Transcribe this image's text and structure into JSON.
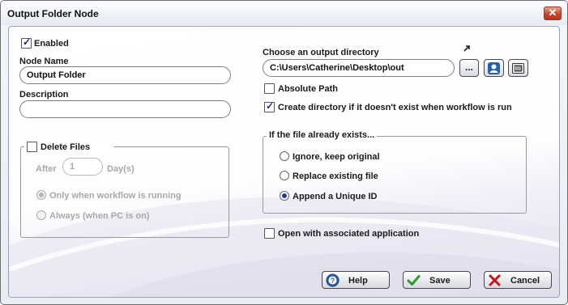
{
  "window": {
    "title": "Output Folder Node",
    "close_glyph": "✕"
  },
  "left": {
    "enabled_label": "Enabled",
    "enabled_checked": true,
    "node_name_label": "Node Name",
    "node_name_value": "Output Folder",
    "description_label": "Description",
    "description_value": ""
  },
  "delete_files": {
    "label": "Delete Files",
    "checked": false,
    "after_label": "After",
    "after_value": "1",
    "days_label": "Day(s)",
    "options": [
      {
        "label": "Only when workflow is running",
        "selected": true
      },
      {
        "label": "Always (when PC is on)",
        "selected": false
      }
    ]
  },
  "output": {
    "choose_label": "Choose an output directory",
    "directory_value": "C:\\Users\\Catherine\\Desktop\\out",
    "browse_label": "...",
    "absolute_path_label": "Absolute Path",
    "absolute_path_checked": false,
    "create_dir_label": "Create directory if it doesn't exist when workflow is run",
    "create_dir_checked": true
  },
  "exists_group": {
    "legend": "If the file already exists...",
    "options": [
      {
        "label": "Ignore, keep original",
        "selected": false
      },
      {
        "label": "Replace existing file",
        "selected": false
      },
      {
        "label": "Append a Unique ID",
        "selected": true
      }
    ]
  },
  "open_with": {
    "label": "Open with associated application",
    "checked": false
  },
  "buttons": {
    "help": "Help",
    "save": "Save",
    "cancel": "Cancel"
  },
  "icons": {
    "external_link": "arrow-up-right-icon",
    "user_vars": "user-variables-icon",
    "tokens": "tokens-icon"
  },
  "colors": {
    "accent": "#1f3d8a",
    "close": "#c7472d",
    "save_check": "#2e9a2e",
    "cancel_x": "#c2161b",
    "help": "#2b5fa8"
  }
}
